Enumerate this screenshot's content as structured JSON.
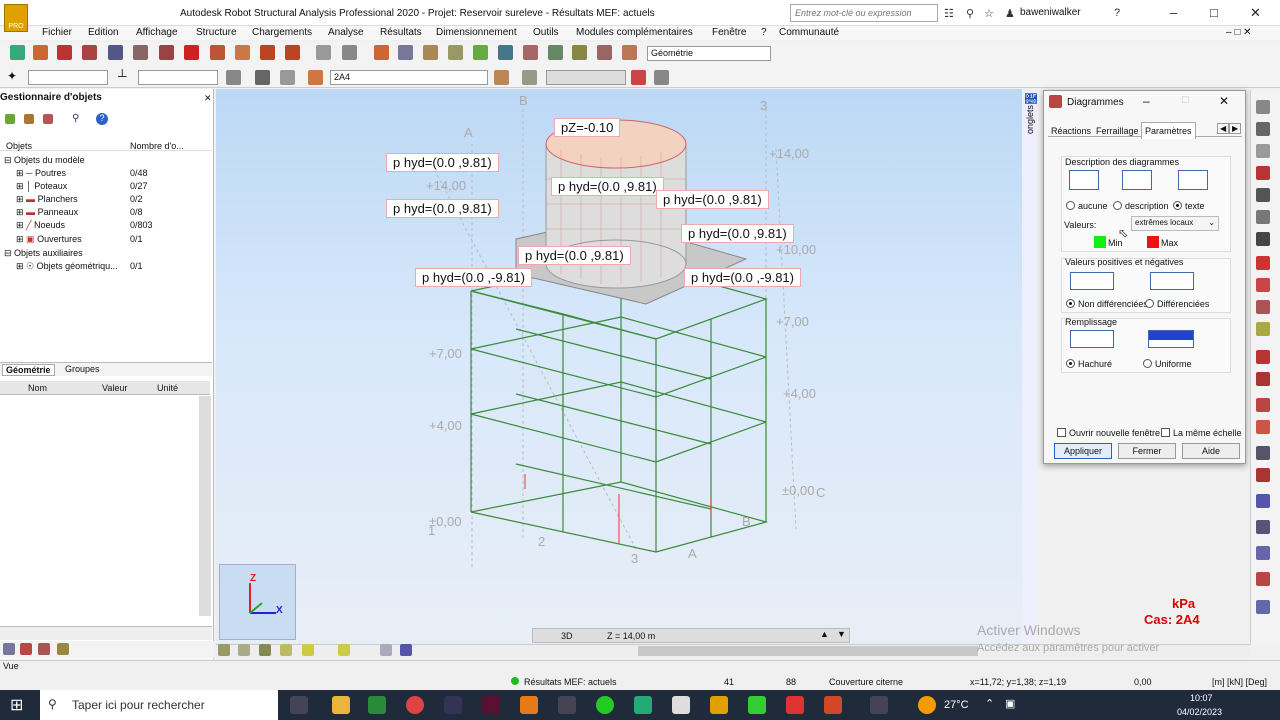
{
  "app": {
    "title": "Autodesk Robot Structural Analysis Professional 2020 - Projet: Reservoir sureleve - Résultats MEF: actuels",
    "icon_label": "PRO",
    "search_placeholder": "Entrez mot-clé ou expression",
    "user": "baweniwalker"
  },
  "menu": [
    "Fichier",
    "Edition",
    "Affichage",
    "Structure",
    "Chargements",
    "Analyse",
    "Résultats",
    "Dimensionnement",
    "Outils",
    "Modules complémentaires",
    "Fenêtre",
    "?",
    "Communauté"
  ],
  "toolbar": {
    "view_combo": "Géométrie",
    "case_combo": "2A4"
  },
  "object_manager": {
    "title": "Gestionnaire d'objets",
    "col_objects": "Objets",
    "col_count": "Nombre d'o...",
    "model_group": "Objets du modèle",
    "items": [
      {
        "label": "Poutres",
        "count": "0/48"
      },
      {
        "label": "Poteaux",
        "count": "0/27"
      },
      {
        "label": "Planchers",
        "count": "0/2"
      },
      {
        "label": "Panneaux",
        "count": "0/8"
      },
      {
        "label": "Noeuds",
        "count": "0/803"
      },
      {
        "label": "Ouvertures",
        "count": "0/1"
      }
    ],
    "aux_group": "Objets auxiliaires",
    "aux_item": {
      "label": "Objets géométriqu...",
      "count": "0/1"
    },
    "tabs": [
      "Géométrie",
      "Groupes"
    ],
    "prop_headers": [
      "Nom",
      "Valeur",
      "Unité"
    ]
  },
  "viewport": {
    "labels": [
      "pZ=-0.10",
      "p hyd=(0.0     ,9.81)",
      "p hyd=(0.0     ,9.81)",
      "p hyd=(0.0     ,9.81)",
      "p hyd=(0.0     ,9.81)",
      "p hyd=(0.0     ,9.81)",
      "p hyd=(0.0     ,9.81)",
      "p hyd=(0.0     ,-9.81)",
      "p hyd=(0.0     ,-9.81)"
    ],
    "levels": [
      "+14,00",
      "+14,00",
      "+10,00",
      "+7,00",
      "+7,00",
      "+4,00",
      "+4,00",
      "±0,00",
      "±0,00"
    ],
    "axes": [
      "A",
      "B",
      "3",
      "1",
      "2",
      "3",
      "A",
      "B",
      "C"
    ],
    "unit": "kPa",
    "case": "Cas: 2A4",
    "bottom_tab": "3D",
    "z_value": "Z = 14,00 m",
    "watermark": "Activer Windows",
    "watermark_sub": "Accédez aux paramètres pour activer",
    "axis_x": "X",
    "axis_z": "Z"
  },
  "dialog": {
    "title": "Diagrammes",
    "tabs": [
      "Réactions",
      "Ferraillage",
      "Paramètres"
    ],
    "desc_group": "Description des diagrammes",
    "desc_opts": [
      "aucune",
      "description",
      "texte"
    ],
    "values_label": "Valeurs:",
    "values_select": "extrêmes locaux",
    "min": "Min",
    "max": "Max",
    "posneg_group": "Valeurs positives et négatives",
    "posneg_opts": [
      "Non différenciées",
      "Différenciées"
    ],
    "fill_group": "Remplissage",
    "fill_opts": [
      "Hachuré",
      "Uniforme"
    ],
    "new_window": "Ouvrir nouvelle fenêtre",
    "same_scale": "La même échelle",
    "buttons": [
      "Appliquer",
      "Fermer",
      "Aide"
    ]
  },
  "status": {
    "view_label": "Vue",
    "results": "Résultats MEF: actuels",
    "n1": "41",
    "n2": "88",
    "object": "Couverture citerne",
    "coords": "x=11,72; y=1,38; z=1,19",
    "value": "0,00",
    "units": "[m] [kN] [Deg]"
  },
  "taskbar": {
    "search": "Taper ici pour rechercher",
    "temp": "27°C",
    "time": "10:07",
    "date": "04/02/2023"
  }
}
